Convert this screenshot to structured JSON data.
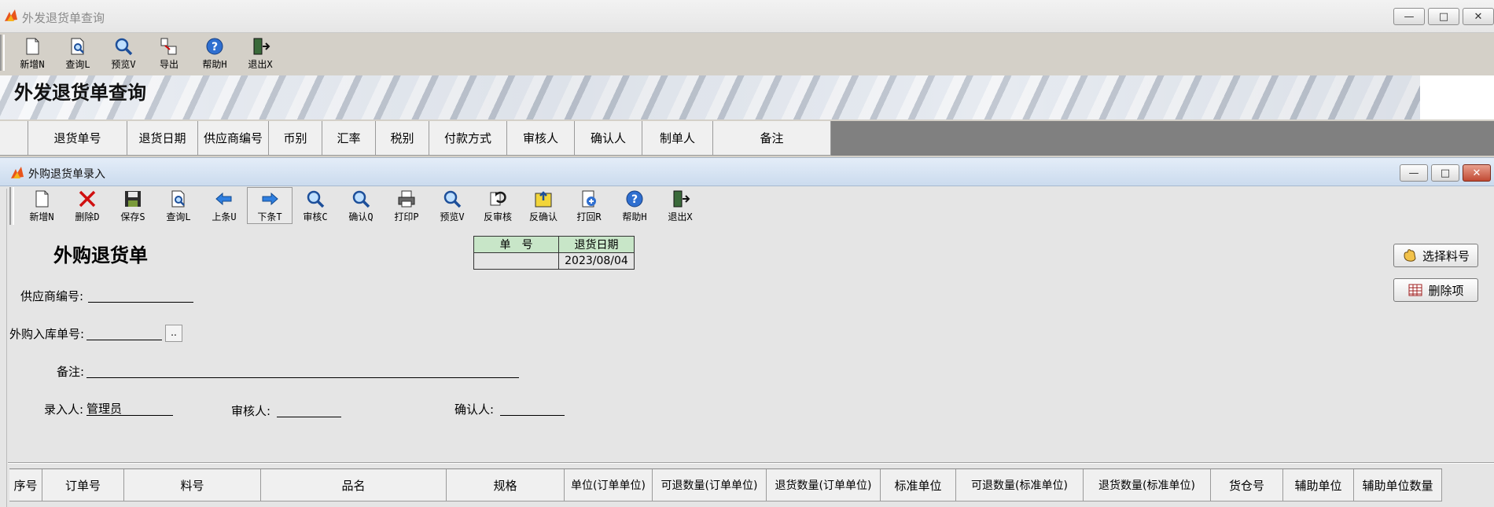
{
  "outer_window": {
    "title": "外发退货单查询",
    "toolbar": [
      {
        "label": "新增N",
        "icon": "new-document-icon"
      },
      {
        "label": "查询L",
        "icon": "query-icon"
      },
      {
        "label": "预览V",
        "icon": "magnifier-icon"
      },
      {
        "label": "导出",
        "icon": "export-icon"
      },
      {
        "label": "帮助H",
        "icon": "help-icon"
      },
      {
        "label": "退出X",
        "icon": "exit-icon"
      }
    ],
    "banner_title": "外发退货单查询",
    "grid_headers": [
      "",
      "退货单号",
      "退货日期",
      "供应商编号",
      "币别",
      "汇率",
      "税别",
      "付款方式",
      "审核人",
      "确认人",
      "制单人",
      "备注"
    ]
  },
  "inner_window": {
    "title": "外购退货单录入",
    "toolbar": [
      {
        "label": "新增N",
        "icon": "new-document-icon"
      },
      {
        "label": "删除D",
        "icon": "delete-x-icon"
      },
      {
        "label": "保存S",
        "icon": "save-disk-icon"
      },
      {
        "label": "查询L",
        "icon": "query-icon"
      },
      {
        "label": "上条U",
        "icon": "arrow-left-icon"
      },
      {
        "label": "下条T",
        "icon": "arrow-right-icon",
        "pressed": true
      },
      {
        "label": "审核C",
        "icon": "magnifier-icon"
      },
      {
        "label": "确认Q",
        "icon": "magnifier-icon"
      },
      {
        "label": "打印P",
        "icon": "printer-icon"
      },
      {
        "label": "预览V",
        "icon": "magnifier-icon"
      },
      {
        "label": "反审核",
        "icon": "unaudit-icon"
      },
      {
        "label": "反确认",
        "icon": "unconfirm-icon"
      },
      {
        "label": "打回R",
        "icon": "return-icon"
      },
      {
        "label": "帮助H",
        "icon": "help-icon"
      },
      {
        "label": "退出X",
        "icon": "exit-icon"
      }
    ],
    "form_title": "外购退货单",
    "doc_table": {
      "col1_header": "单　号",
      "col2_header": "退货日期",
      "doc_no": "",
      "date": "2023/08/04"
    },
    "fields": {
      "supplier_label": "供应商编号:",
      "supplier_value": "",
      "inbound_label": "外购入库单号:",
      "inbound_value": "",
      "inbound_button": "..",
      "remark_label": "备注:",
      "remark_value": "",
      "entry_label": "录入人:",
      "entry_value": "管理员",
      "auditor_label": "审核人:",
      "auditor_value": "",
      "confirmer_label": "确认人:",
      "confirmer_value": ""
    },
    "side_buttons": {
      "select_item": "选择料号",
      "delete_item": "删除项"
    },
    "detail_headers": [
      "序号",
      "订单号",
      "料号",
      "品名",
      "规格",
      "单位(订单单位)",
      "可退数量(订单单位)",
      "退货数量(订单单位)",
      "标准单位",
      "可退数量(标准单位)",
      "退货数量(标准单位)",
      "货仓号",
      "辅助单位",
      "辅助单位数量"
    ]
  },
  "window_buttons": {
    "minimize": "—",
    "maximize": "□",
    "close": "✕"
  },
  "colors": {
    "doc_header_bg": "#c8e6c8",
    "grid_bg": "#808080",
    "close_btn": "#c14a34"
  }
}
